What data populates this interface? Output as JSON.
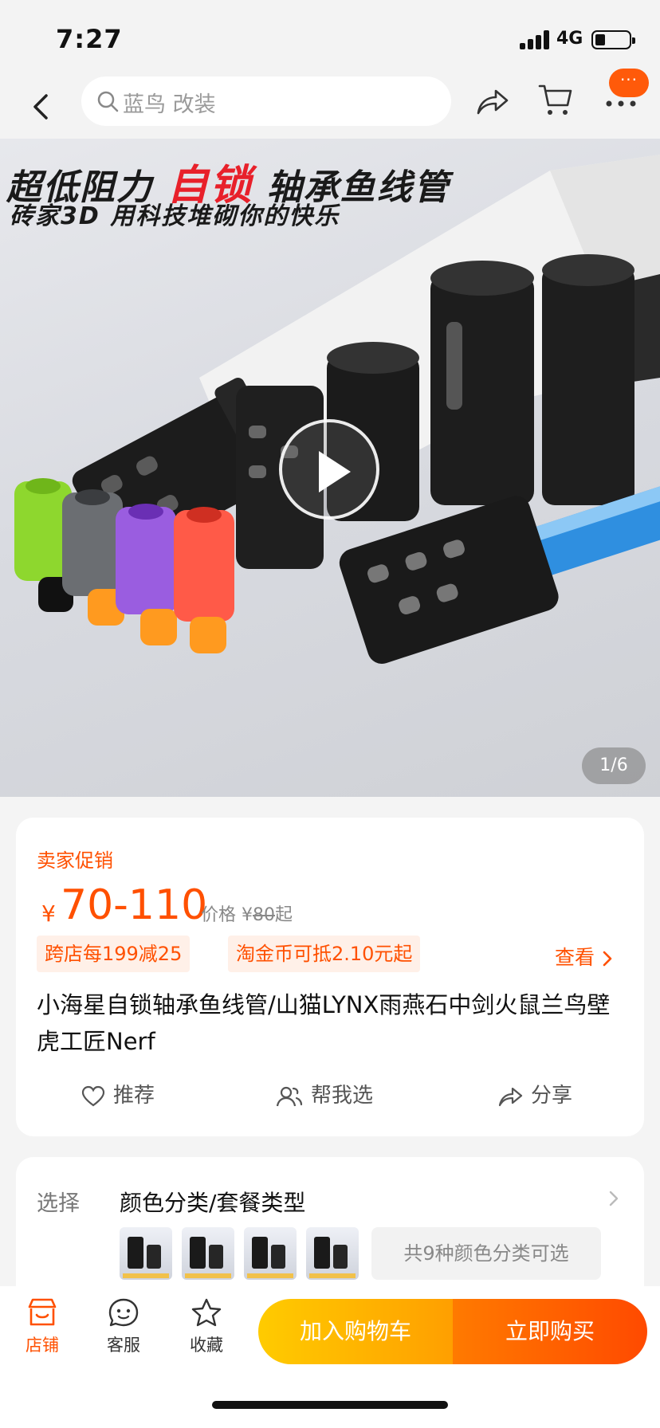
{
  "status": {
    "time": "7:27",
    "network": "4G"
  },
  "nav": {
    "search_text": "蓝鸟 改装",
    "more_dots": "···"
  },
  "hero": {
    "banner_pre": "超低阻力 ",
    "banner_highlight": "自锁",
    "banner_post": " 轴承鱼线管",
    "banner_line2": "砖家3D  用科技堆砌你的快乐",
    "page_indicator": "1/6"
  },
  "product": {
    "promo_label": "卖家促销",
    "currency": "¥",
    "price_range": "70-110",
    "orig_price_prefix": "价格 ¥",
    "orig_price_value": "80",
    "orig_price_suffix": "起",
    "coupons": [
      "跨店每199减25",
      "淘金币可抵2.10元起"
    ],
    "view_label": "查看",
    "title": "小海星自锁轴承鱼线管/山猫LYNX雨燕石中剑火鼠兰鸟壁虎工匠Nerf",
    "actions": {
      "recommend": "推荐",
      "help_choose": "帮我选",
      "share": "分享"
    }
  },
  "select": {
    "label": "选择",
    "title": "颜色分类/套餐类型",
    "variant_count_text": "共9种颜色分类可选"
  },
  "bottom": {
    "shop": "店铺",
    "service": "客服",
    "favorite": "收藏",
    "add_to_cart": "加入购物车",
    "buy_now": "立即购买"
  },
  "colors": {
    "accent": "#ff5000",
    "cart_button": "#ffb000",
    "buy_button": "#ff5a00"
  }
}
